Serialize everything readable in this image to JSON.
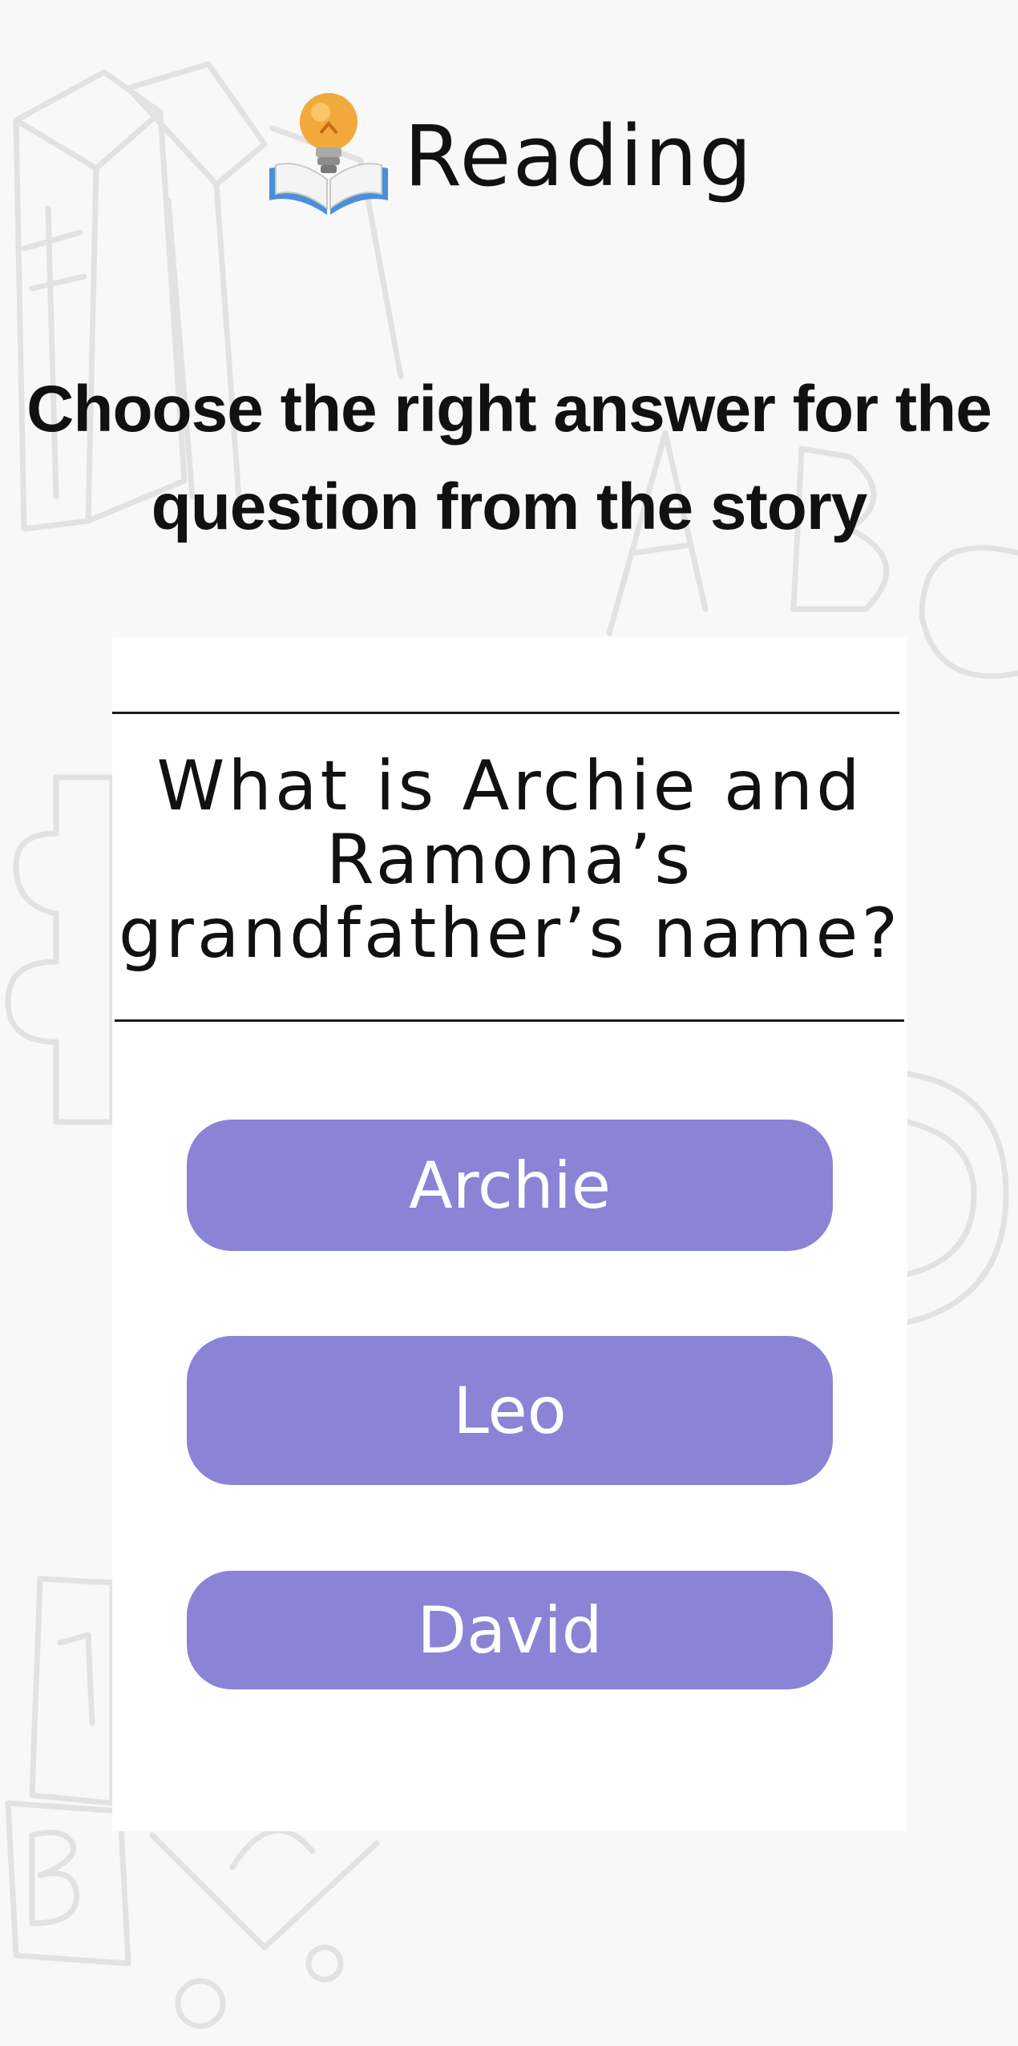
{
  "header": {
    "icon": "book-lightbulb-icon",
    "title": "Reading"
  },
  "instruction": "Choose the right answer for the question from the story",
  "question": {
    "text": "What is Archie and Ramona’s grandfather’s name?"
  },
  "answers": [
    {
      "label": "Archie"
    },
    {
      "label": "Leo"
    },
    {
      "label": "David"
    }
  ],
  "colors": {
    "background": "#f8f8f8",
    "card": "#ffffff",
    "answer_button": "#8a83d6",
    "answer_text": "#ffffff",
    "doodle_stroke": "#e3e3e3"
  }
}
